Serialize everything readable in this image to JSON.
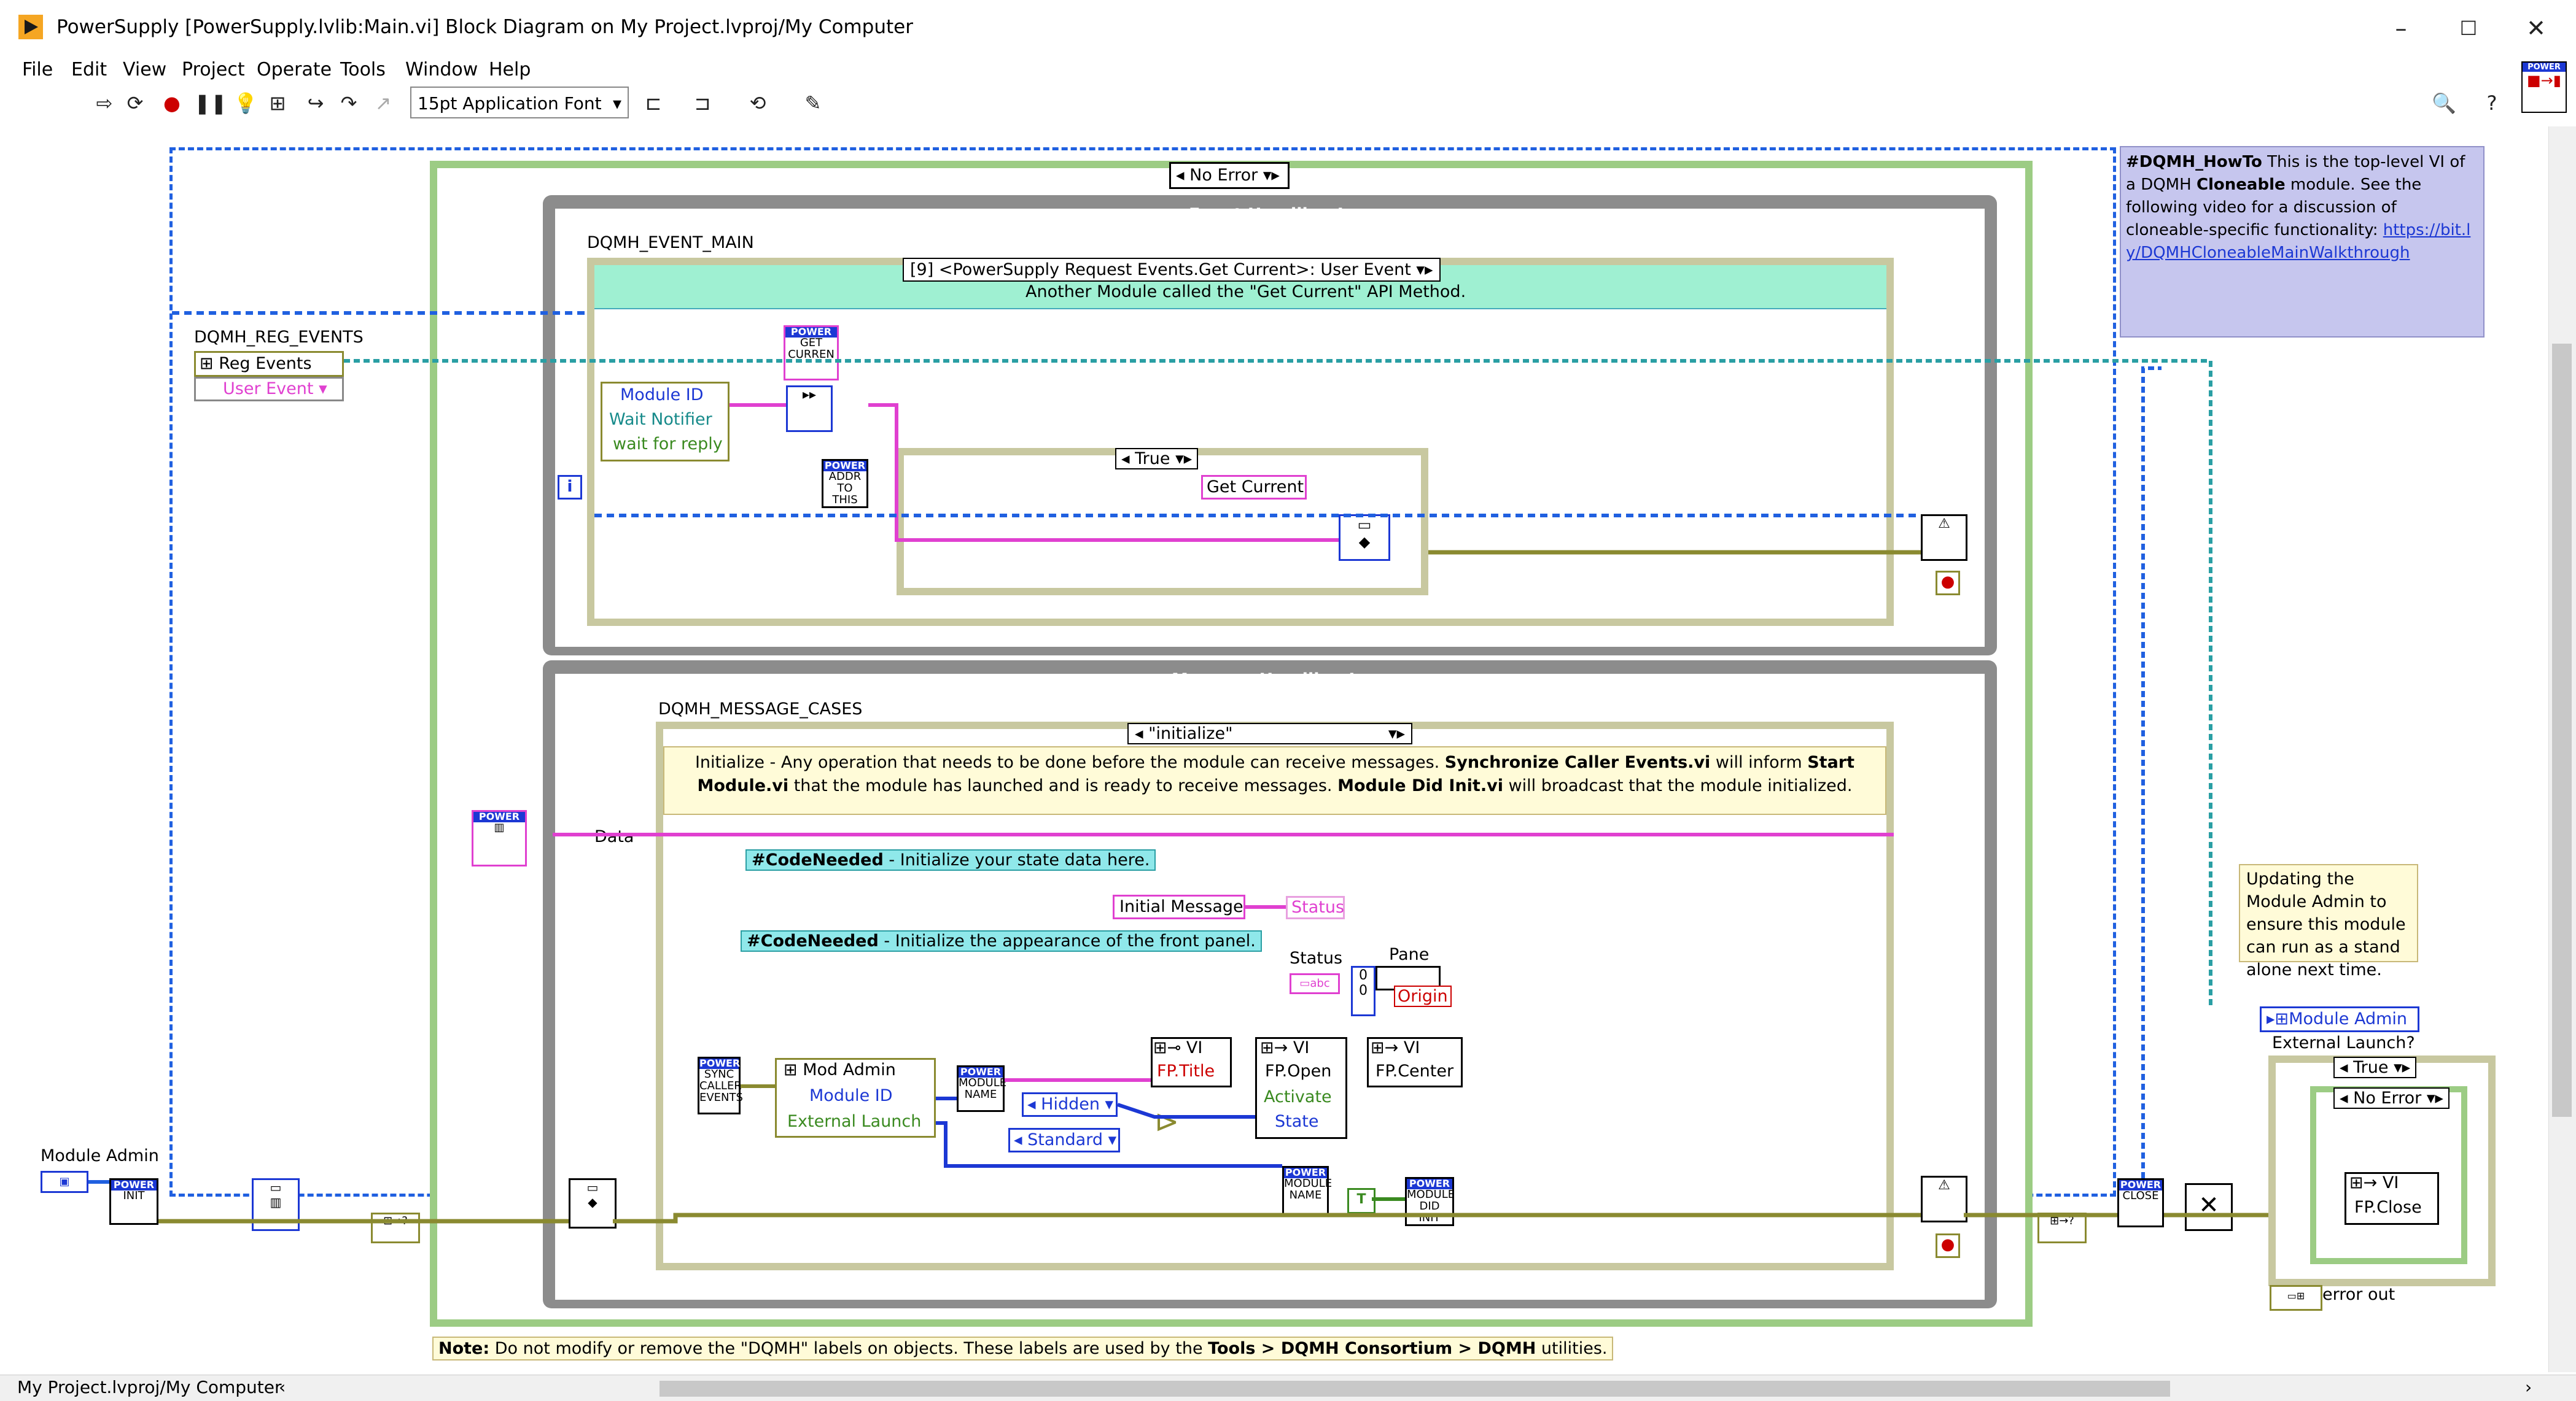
{
  "window": {
    "title": "PowerSupply [PowerSupply.lvlib:Main.vi] Block Diagram on My Project.lvproj/My Computer",
    "controls": [
      "–",
      "☐",
      "✕"
    ]
  },
  "menubar": [
    "File",
    "Edit",
    "View",
    "Project",
    "Operate",
    "Tools",
    "Window",
    "Help"
  ],
  "toolbar": {
    "font": "15pt Application Font",
    "power_icon": "POWER"
  },
  "diagram": {
    "outer_case": "No Error",
    "event_loop_title": "Event Handling Loop",
    "event_main_label": "DQMH_EVENT_MAIN",
    "event_case": "[9] <PowerSupply Request Events.Get Current>: User Event",
    "event_desc": "Another Module called the \"Get Current\" API Method.",
    "reg_events_label": "DQMH_REG_EVENTS",
    "reg_events": "Reg Events",
    "user_event": "User Event",
    "module_id": "Module ID",
    "wait_notifier": "Wait Notifier",
    "wait_for_reply": "wait for reply",
    "true_case": "True",
    "get_current": "Get Current",
    "msg_loop_title": "Message Handling Loop",
    "msg_cases_label": "DQMH_MESSAGE_CASES",
    "msg_case": "\"initialize\"",
    "init_note_1": "Initialize - Any operation that needs to be done before the module can receive messages. ",
    "init_note_b1": "Synchronize Caller Events.vi",
    "init_note_2": " will inform ",
    "init_note_b2": "Start Module.vi",
    "init_note_3": " that the module has launched and is ready to receive messages. ",
    "init_note_b3": "Module Did Init.vi",
    "init_note_4": " will broadcast that the module initialized.",
    "data": "Data",
    "code_needed_1": "#CodeNeeded",
    "code_needed_1_text": " - Initialize your state data here.",
    "code_needed_2": "#CodeNeeded",
    "code_needed_2_text": " - Initialize the appearance of the front panel.",
    "initial_message": "Initial Message",
    "status": "Status",
    "status2": "Status",
    "pane": "Pane",
    "origin": "Origin",
    "mod_admin": "Mod Admin",
    "module_id2": "Module ID",
    "external_launch": "External Launch",
    "hidden": "Hidden",
    "standard": "Standard",
    "fp_title": "FP.Title",
    "fp_open": "FP.Open",
    "activate": "Activate",
    "state": "State",
    "fp_center": "FP.Center",
    "vi": "VI",
    "module_admin": "Module Admin",
    "module_admin_right": "Module Admin",
    "external_launch_q": "External Launch?",
    "true_case2": "True",
    "no_error2": "No Error",
    "fp_close": "FP.Close",
    "error_out": "error out",
    "updating_note": "Updating the Module Admin to ensure this module can run as a stand alone next time.",
    "howto_tag": "#DQMH_HowTo",
    "howto_text_1": " This is the top-level VI of a DQMH ",
    "howto_bold": "Cloneable",
    "howto_text_2": " module. See the following video for a discussion of cloneable-specific functionality: ",
    "howto_link": "https://bit.ly/DQMHCloneableMainWalkthrough",
    "bottom_note_b": "Note:",
    "bottom_note_1": " Do not modify or remove the \"DQMH\" labels on objects. These labels are used by the ",
    "bottom_note_b2": "Tools > DQMH Consortium > DQMH",
    "bottom_note_2": " utilities."
  },
  "statusbar": {
    "path": "My Project.lvproj/My Computer"
  }
}
